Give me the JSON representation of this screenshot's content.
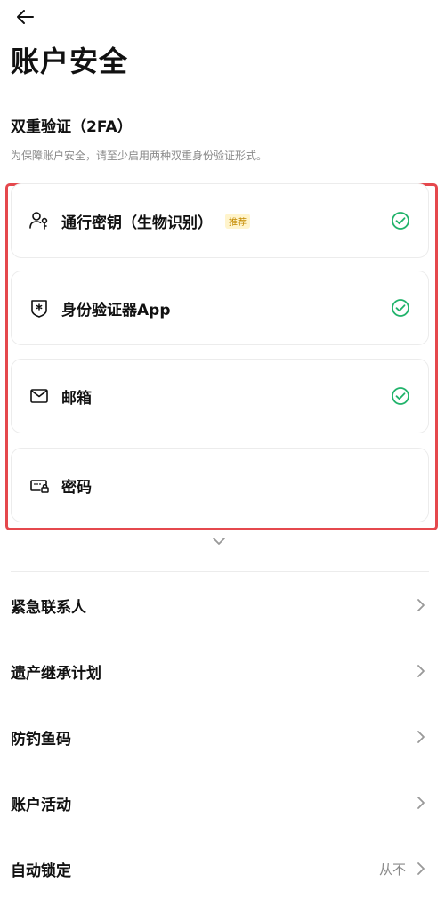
{
  "header": {
    "back_icon": "arrow-left-icon",
    "title": "账户安全"
  },
  "twofa": {
    "title": "双重验证（2FA）",
    "description": "为保障账户安全，请至少启用两种双重身份验证形式。",
    "methods": [
      {
        "label": "通行密钥（生物识别）",
        "badge": "推荐",
        "icon": "passkey-user-icon",
        "enabled": true
      },
      {
        "label": "身份验证器App",
        "icon": "authenticator-shield-icon",
        "enabled": true
      },
      {
        "label": "邮箱",
        "icon": "mail-icon",
        "enabled": true
      },
      {
        "label": "密码",
        "icon": "password-keyboard-lock-icon",
        "enabled": false
      }
    ],
    "highlight_color": "#e5484d",
    "check_color": "#21b36b"
  },
  "menu": {
    "items": [
      {
        "label": "紧急联系人",
        "value": ""
      },
      {
        "label": "遗产继承计划",
        "value": ""
      },
      {
        "label": "防钓鱼码",
        "value": ""
      },
      {
        "label": "账户活动",
        "value": ""
      },
      {
        "label": "自动锁定",
        "value": "从不"
      }
    ]
  }
}
